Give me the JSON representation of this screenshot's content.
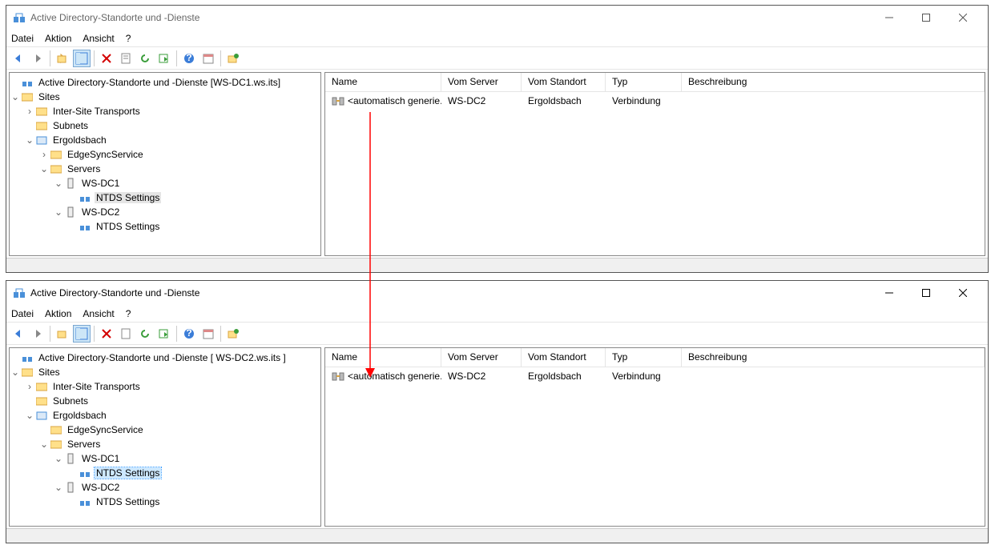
{
  "windows": [
    {
      "title": "Active Directory-Standorte und -Dienste",
      "menus": [
        "Datei",
        "Aktion",
        "Ansicht",
        "?"
      ],
      "tree_root": "Active Directory-Standorte und -Dienste [WS-DC1.ws.its]",
      "tree": {
        "sites": "Sites",
        "ist": "Inter-Site Transports",
        "subnets": "Subnets",
        "site1": "Ergoldsbach",
        "edge": "EdgeSyncService",
        "servers": "Servers",
        "dc1": "WS-DC1",
        "ntds1": "NTDS Settings",
        "dc2": "WS-DC2",
        "ntds2": "NTDS Settings"
      },
      "columns": [
        "Name",
        "Vom Server",
        "Vom Standort",
        "Typ",
        "Beschreibung"
      ],
      "row": {
        "name": "<automatisch generie...",
        "server": "WS-DC2",
        "standort": "Ergoldsbach",
        "typ": "Verbindung",
        "beschr": ""
      }
    },
    {
      "title": "Active Directory-Standorte und -Dienste",
      "menus": [
        "Datei",
        "Aktion",
        "Ansicht",
        "?"
      ],
      "tree_root": "Active Directory-Standorte und -Dienste [ WS-DC2.ws.its ]",
      "tree": {
        "sites": "Sites",
        "ist": "Inter-Site Transports",
        "subnets": "Subnets",
        "site1": "Ergoldsbach",
        "edge": "EdgeSyncService",
        "servers": "Servers",
        "dc1": "WS-DC1",
        "ntds1": "NTDS Settings",
        "dc2": "WS-DC2",
        "ntds2": "NTDS Settings"
      },
      "columns": [
        "Name",
        "Vom Server",
        "Vom Standort",
        "Typ",
        "Beschreibung"
      ],
      "row": {
        "name": "<automatisch generie...",
        "server": "WS-DC2",
        "standort": "Ergoldsbach",
        "typ": "Verbindung",
        "beschr": ""
      }
    }
  ]
}
